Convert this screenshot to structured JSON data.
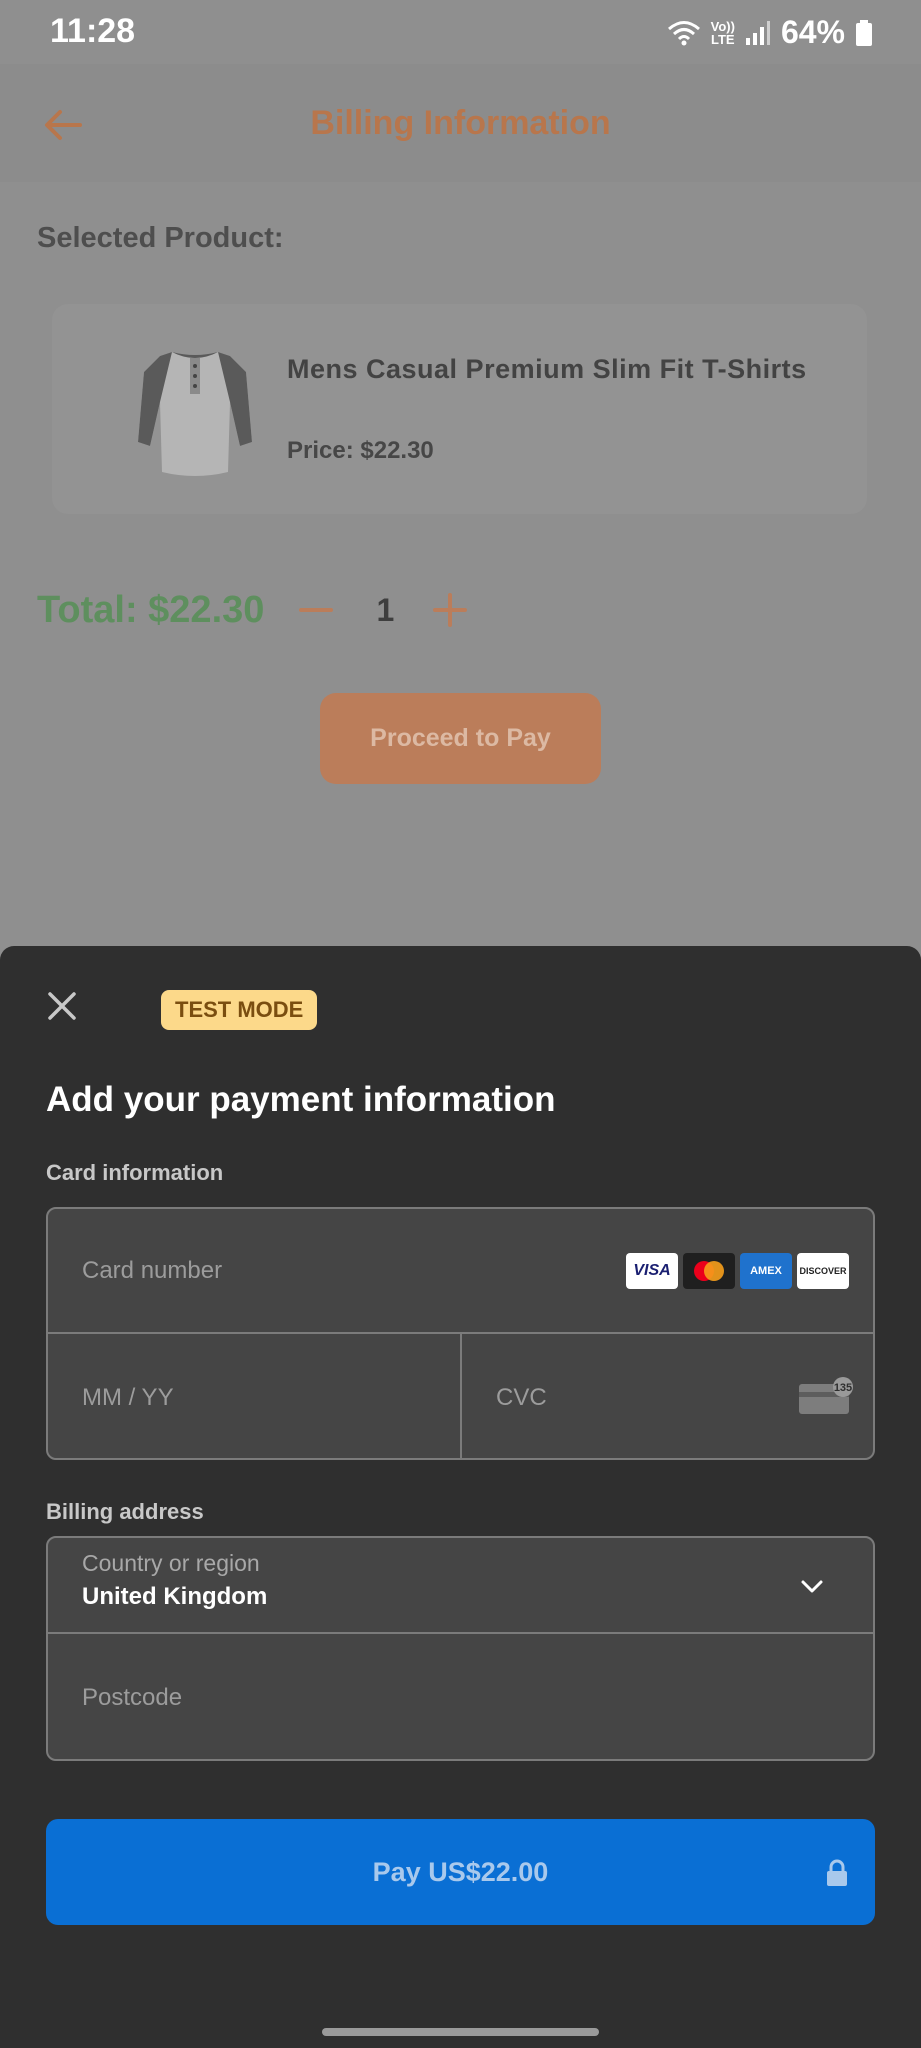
{
  "status_bar": {
    "time": "11:28",
    "battery": "64%",
    "network": "Vo)) LTE"
  },
  "app_bar": {
    "title": "Billing Information"
  },
  "selected_label": "Selected Product:",
  "product": {
    "name": "Mens Casual Premium Slim Fit T-Shirts",
    "price": "Price: $22.30"
  },
  "total": {
    "text": "Total: $22.30",
    "quantity": "1"
  },
  "proceed_label": "Proceed to Pay",
  "sheet": {
    "badge": "TEST MODE",
    "title": "Add your payment information",
    "card_label": "Card information",
    "card_number_placeholder": "Card number",
    "brands": [
      "VISA",
      "Mastercard",
      "AMEX",
      "DISCOVER"
    ],
    "expiry_placeholder": "MM / YY",
    "cvc_placeholder": "CVC",
    "cvc_hint": "135",
    "billing_label": "Billing address",
    "country_label": "Country or region",
    "country_value": "United Kingdom",
    "postcode_placeholder": "Postcode",
    "pay_label": "Pay US$22.00"
  },
  "colors": {
    "accent": "#bb7d5a",
    "pay_button": "#0a6fd4",
    "total_green": "#5e8f5e",
    "badge": "#fcd98a"
  }
}
